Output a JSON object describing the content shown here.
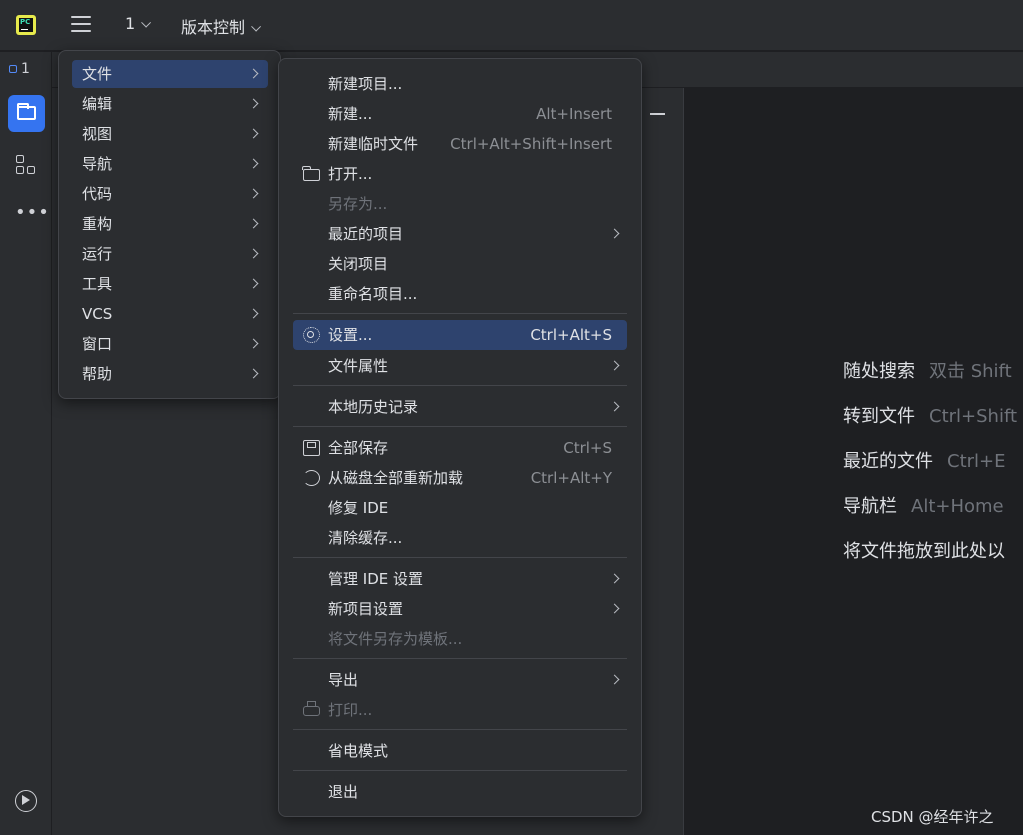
{
  "titlebar": {
    "project_number": "1",
    "vcs_label": "版本控制"
  },
  "project_tab": {
    "label": "1"
  },
  "main_menu": {
    "items": [
      {
        "label": "文件"
      },
      {
        "label": "编辑"
      },
      {
        "label": "视图"
      },
      {
        "label": "导航"
      },
      {
        "label": "代码"
      },
      {
        "label": "重构"
      },
      {
        "label": "运行"
      },
      {
        "label": "工具"
      },
      {
        "label": "VCS"
      },
      {
        "label": "窗口"
      },
      {
        "label": "帮助"
      }
    ]
  },
  "file_menu": {
    "new_project": "新建项目...",
    "new": "新建...",
    "new_shortcut": "Alt+Insert",
    "new_scratch": "新建临时文件",
    "new_scratch_shortcut": "Ctrl+Alt+Shift+Insert",
    "open": "打开...",
    "save_as": "另存为...",
    "recent_projects": "最近的项目",
    "close_project": "关闭项目",
    "rename_project": "重命名项目...",
    "settings": "设置...",
    "settings_shortcut": "Ctrl+Alt+S",
    "file_properties": "文件属性",
    "local_history": "本地历史记录",
    "save_all": "全部保存",
    "save_all_shortcut": "Ctrl+S",
    "reload_all": "从磁盘全部重新加载",
    "reload_all_shortcut": "Ctrl+Alt+Y",
    "repair_ide": "修复 IDE",
    "invalidate_caches": "清除缓存...",
    "manage_ide_settings": "管理 IDE 设置",
    "new_project_settings": "新项目设置",
    "save_as_template": "将文件另存为模板...",
    "export": "导出",
    "print": "打印...",
    "power_save": "省电模式",
    "exit": "退出"
  },
  "welcome": {
    "rows": [
      {
        "label": "随处搜索",
        "shortcut": "双击 Shift"
      },
      {
        "label": "转到文件",
        "shortcut": "Ctrl+Shift"
      },
      {
        "label": "最近的文件",
        "shortcut": "Ctrl+E"
      },
      {
        "label": "导航栏",
        "shortcut": "Alt+Home"
      },
      {
        "label": "将文件拖放到此处以",
        "shortcut": ""
      }
    ]
  },
  "watermark": "CSDN @经年许之",
  "colors": {
    "background": "#1e1f22",
    "panel": "#2b2d30",
    "selection": "#2e436e",
    "accent": "#3574f0",
    "text": "#dfe1e5",
    "muted_text": "#6f737a"
  },
  "icons": {
    "app_logo": "pycharm-logo-icon",
    "main_menu": "hamburger-menu-icon",
    "project_tool": "folder-icon",
    "structure_tool": "structure-icon",
    "more_tools": "more-dots-icon",
    "run_tool": "run-icon",
    "open": "folder-icon",
    "settings": "gear-icon",
    "save_all": "save-icon",
    "reload": "reload-icon",
    "print": "printer-icon"
  }
}
